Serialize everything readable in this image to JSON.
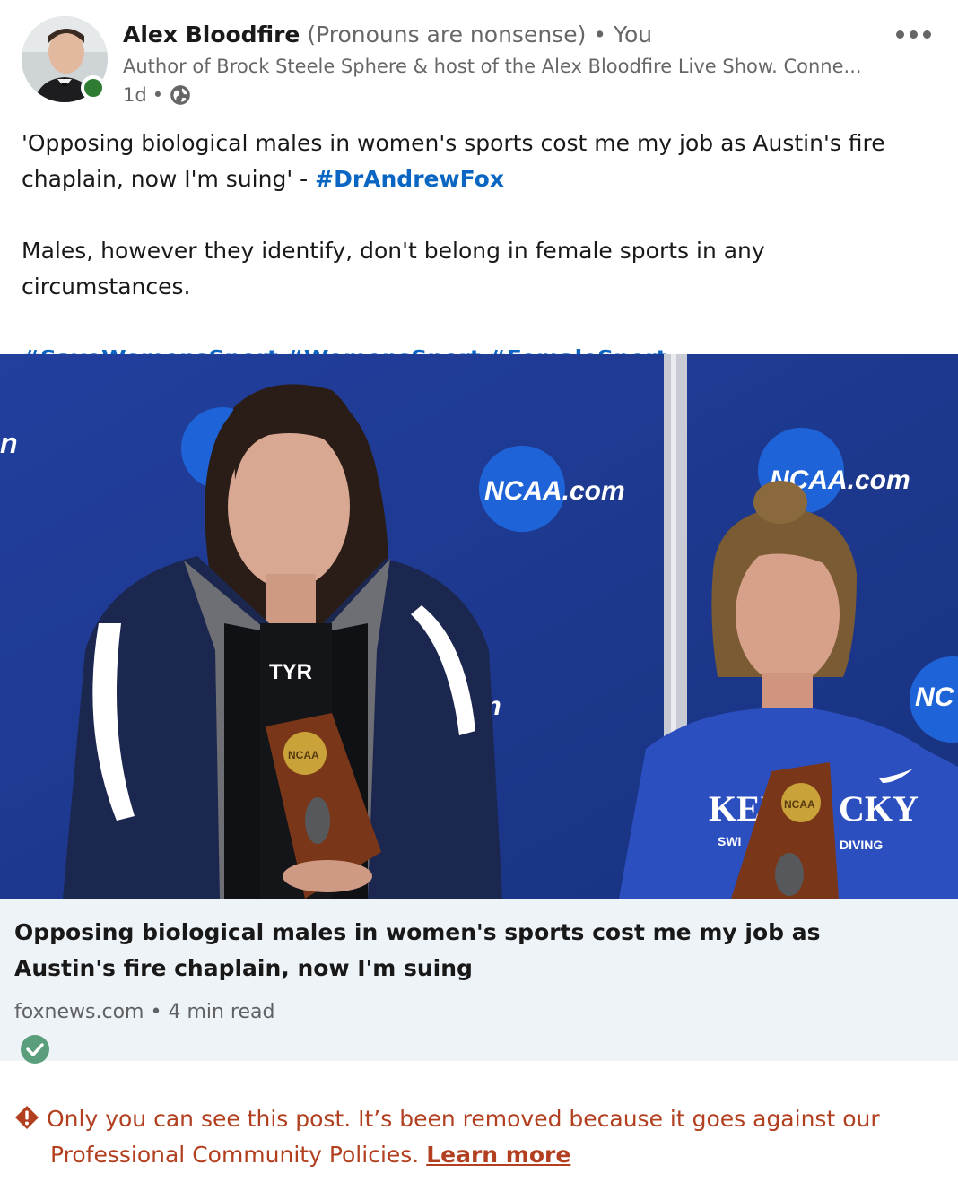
{
  "post": {
    "author": {
      "name": "Alex Bloodfire",
      "pronouns": "(Pronouns are nonsense)",
      "separator": "•",
      "relation": "You",
      "headline": "Author of Brock Steele Sphere & host of the Alex Bloodfire Live Show. Conne...",
      "time": "1d",
      "time_separator": "•",
      "visibility_icon": "globe-icon"
    },
    "text": {
      "line1": "'Opposing biological males in women's sports cost me my job as Austin's fire chaplain, now I'm suing' - ",
      "mention_hashtag": "#DrAndrewFox",
      "line2": "Males, however they identify, don't belong in female sports in any circumstances.",
      "hashtags": [
        "#SaveWomensSport",
        "#WomensSport",
        "#FemaleSport"
      ]
    },
    "image": {
      "backdrop_labels": [
        "NCAA.com",
        "NCAA.com",
        "NC",
        "m",
        "n"
      ],
      "left_logo": "TYR",
      "trophy_label": "NCAA",
      "shirt_text": [
        "KEN",
        "CKY",
        "SWI",
        "DIVING"
      ],
      "colors": {
        "backdrop": "#1f3f9a",
        "ncaa_circle": "#1d5fd0"
      }
    },
    "article": {
      "title": "Opposing biological males in women's sports cost me my job as Austin's fire chaplain, now I'm suing",
      "source": "foxnews.com",
      "source_separator": "•",
      "read_time": "4 min read",
      "verified_icon": "check-circle-icon"
    },
    "removal_notice": {
      "icon": "warning-icon",
      "text_line1": "Only you can see this post. It’s been removed because it goes against our",
      "text_line2": "Professional Community Policies.",
      "link": "Learn more"
    }
  },
  "colors": {
    "link": "#0a66c2",
    "warning": "#b24020",
    "online": "#2e7d32",
    "card_bg": "#eef3f8",
    "verified": "#5a9e7c"
  }
}
